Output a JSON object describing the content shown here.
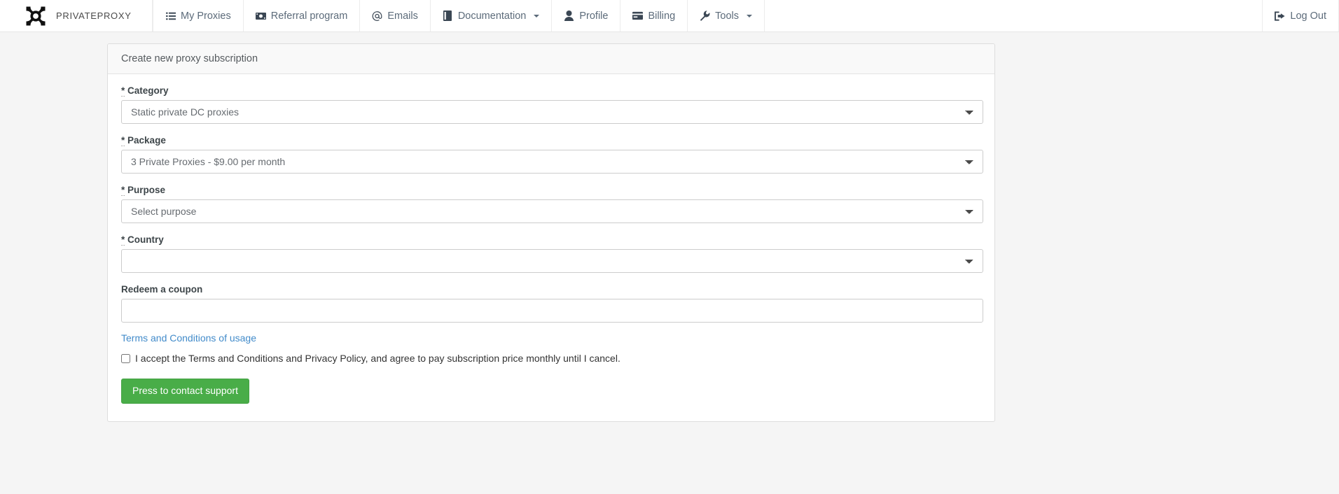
{
  "brand": {
    "name": "PRIVATEPROXY",
    "logo_icon": "privateproxy-logo-icon"
  },
  "nav": {
    "items": [
      {
        "label": "My Proxies",
        "icon": "list-icon",
        "caret": false
      },
      {
        "label": "Referral program",
        "icon": "money-bill-icon",
        "caret": false
      },
      {
        "label": "Emails",
        "icon": "at-sign-icon",
        "caret": false
      },
      {
        "label": "Documentation",
        "icon": "book-icon",
        "caret": true
      },
      {
        "label": "Profile",
        "icon": "user-icon",
        "caret": false
      },
      {
        "label": "Billing",
        "icon": "credit-card-icon",
        "caret": false
      },
      {
        "label": "Tools",
        "icon": "wrench-icon",
        "caret": true
      }
    ],
    "logout": {
      "label": "Log Out",
      "icon": "sign-out-icon"
    }
  },
  "panel": {
    "title": "Create new proxy subscription"
  },
  "form": {
    "required_marker": "*",
    "category": {
      "label": "Category",
      "value": "Static private DC proxies",
      "options": [
        "Static private DC proxies"
      ]
    },
    "package": {
      "label": "Package",
      "value": "3 Private Proxies - $9.00 per month",
      "options": [
        "3 Private Proxies - $9.00 per month"
      ]
    },
    "purpose": {
      "label": "Purpose",
      "value": "Select purpose",
      "options": [
        "Select purpose"
      ]
    },
    "country": {
      "label": "Country",
      "value": "",
      "options": [
        ""
      ]
    },
    "coupon": {
      "label": "Redeem a coupon",
      "value": "",
      "placeholder": ""
    },
    "terms_link": "Terms and Conditions of usage",
    "accept_label": "I accept the Terms and Conditions and Privacy Policy, and agree to pay subscription price monthly until I cancel.",
    "accept_checked": false,
    "submit_label": "Press to contact support"
  },
  "colors": {
    "page_background": "#f5f5f5",
    "panel_background": "#ffffff",
    "panel_heading_background": "#f9f9f9",
    "link": "#428bca",
    "submit_button": "#49ad48",
    "nav_text": "#5c6b7a"
  }
}
